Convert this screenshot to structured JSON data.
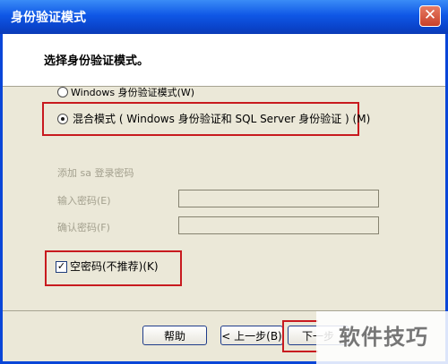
{
  "window": {
    "title": "身份验证模式",
    "close_glyph": "✕"
  },
  "heading": "选择身份验证模式。",
  "options": [
    {
      "label": "Windows 身份验证模式(W)",
      "selected": false
    },
    {
      "label": "混合模式 ( Windows 身份验证和 SQL Server 身份验证 ) (M)",
      "selected": true
    }
  ],
  "password_group": {
    "title": "添加 sa 登录密码",
    "enter_label": "输入密码(E)",
    "confirm_label": "确认密码(F)",
    "enter_value": "",
    "confirm_value": ""
  },
  "blank_password": {
    "label": "空密码(不推荐)(K)",
    "checked": true
  },
  "buttons": {
    "help": "帮助",
    "back": "< 上一步(B)",
    "next": "下一步"
  },
  "watermark": "软件技巧",
  "colors": {
    "accent_red": "#c81a1f",
    "title_blue": "#0a46d8",
    "disabled_gray": "#a3a08e"
  }
}
